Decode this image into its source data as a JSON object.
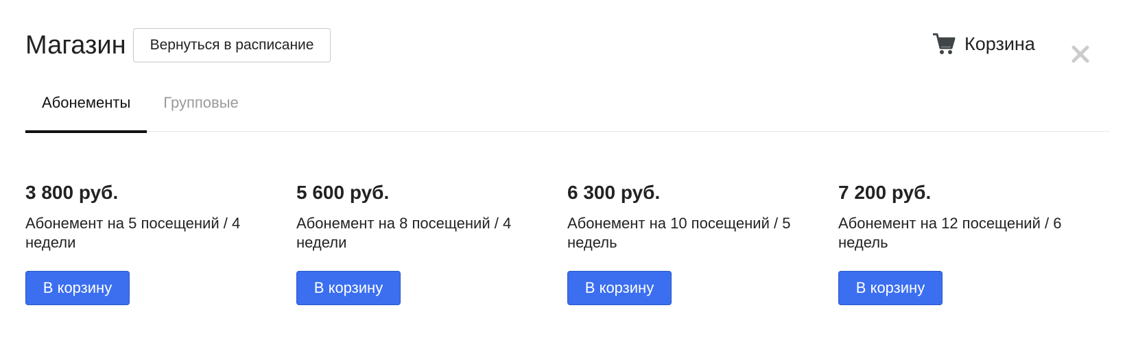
{
  "header": {
    "title": "Магазин",
    "back_label": "Вернуться в расписание"
  },
  "cart": {
    "label": "Корзина",
    "icon": "cart-icon"
  },
  "close": {
    "icon": "close-icon"
  },
  "tabs": [
    {
      "label": "Абонементы",
      "active": true
    },
    {
      "label": "Групповые",
      "active": false
    }
  ],
  "products": [
    {
      "price": "3 800 руб.",
      "description": "Абонемент на 5 посещений / 4 недели",
      "button": "В корзину"
    },
    {
      "price": "5 600 руб.",
      "description": "Абонемент на 8 посещений / 4 недели",
      "button": "В корзину"
    },
    {
      "price": "6 300 руб.",
      "description": "Абонемент на 10 посещений / 5 недель",
      "button": "В корзину"
    },
    {
      "price": "7 200 руб.",
      "description": "Абонемент на 12 посещений / 6 недель",
      "button": "В корзину"
    }
  ],
  "colors": {
    "accent": "#3b6ff0",
    "text": "#222222",
    "muted": "#9a9a9a",
    "close": "#cccccc",
    "cart_icon": "#3f4446"
  }
}
